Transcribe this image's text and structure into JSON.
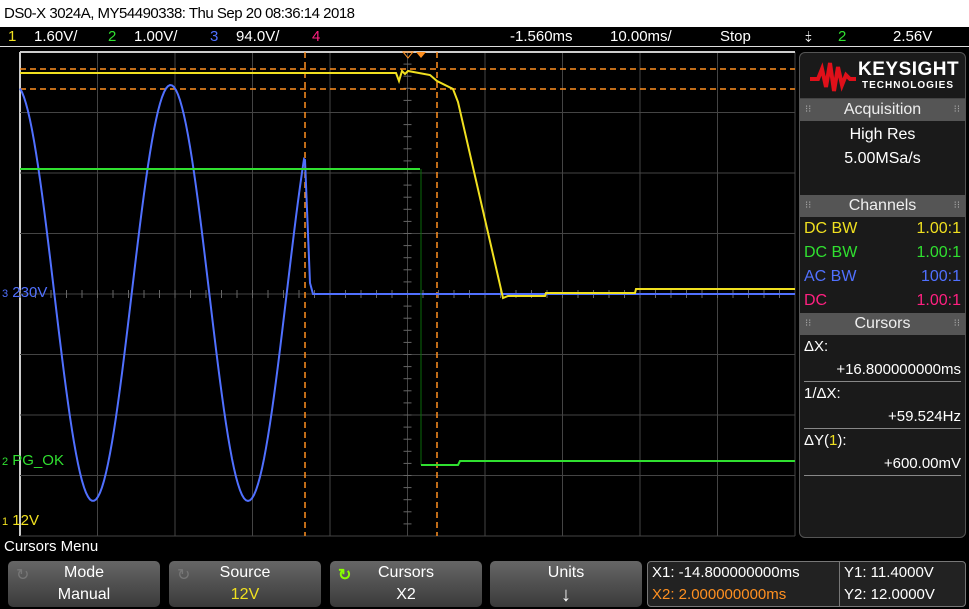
{
  "title": "DS0-X 3024A, MY54490338: Thu Sep 20 08:36:14 2018",
  "status": {
    "ch1_num": "1",
    "ch1_scale": "1.60V/",
    "ch2_num": "2",
    "ch2_scale": "1.00V/",
    "ch3_num": "3",
    "ch3_scale": "94.0V/",
    "ch4_num": "4",
    "delay": "-1.560ms",
    "timebase": "10.00ms/",
    "run_state": "Stop",
    "trigger_icon": "falling-edge",
    "trigger_source": "2",
    "trigger_level": "2.56V"
  },
  "colors": {
    "ch1": "#f0e020",
    "ch2": "#30e030",
    "ch3": "#5070ff",
    "ch4": "#ff2080",
    "cursor": "#ff9020"
  },
  "traces": {
    "ch3_label": "230V",
    "ch3_num": "3",
    "ch2_label": "PG_OK",
    "ch2_num": "2",
    "ch1_label": "12V",
    "ch1_num": "1"
  },
  "brand": {
    "name": "KEYSIGHT",
    "sub": "TECHNOLOGIES"
  },
  "acquisition": {
    "header": "Acquisition",
    "mode": "High Res",
    "rate": "5.00MSa/s"
  },
  "channels": {
    "header": "Channels",
    "rows": [
      {
        "coupling": "DC BW",
        "probe": "1.00:1"
      },
      {
        "coupling": "DC BW",
        "probe": "1.00:1"
      },
      {
        "coupling": "AC BW",
        "probe": "100:1"
      },
      {
        "coupling": "DC",
        "probe": "1.00:1"
      }
    ]
  },
  "cursors": {
    "header": "Cursors",
    "dx_label": "ΔX:",
    "dx": "+16.800000000ms",
    "inv_label": "1/ΔX:",
    "inv": "+59.524Hz",
    "dy_label_pre": "ΔY(",
    "dy_label_ch": "1",
    "dy_label_post": "):",
    "dy": "+600.00mV"
  },
  "menu": {
    "title": "Cursors Menu",
    "keys": [
      {
        "label": "Mode",
        "value": "Manual"
      },
      {
        "label": "Source",
        "value": "12V"
      },
      {
        "label": "Cursors",
        "value": "X2"
      },
      {
        "label": "Units",
        "value": "↓"
      }
    ]
  },
  "readout": {
    "x1": "X1: -14.800000000ms",
    "x2": "X2: 2.000000000ms",
    "y1": "Y1: 11.4000V",
    "y2": "Y2: 12.0000V"
  }
}
